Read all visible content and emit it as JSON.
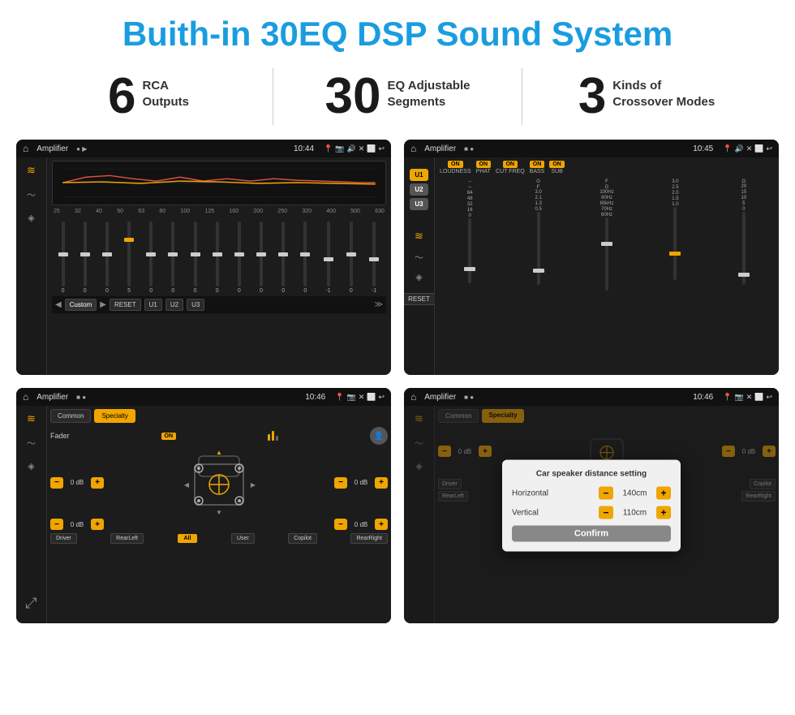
{
  "header": {
    "title": "Buith-in 30EQ DSP Sound System"
  },
  "stats": [
    {
      "number": "6",
      "label": "RCA\nOutputs"
    },
    {
      "number": "30",
      "label": "EQ Adjustable\nSegments"
    },
    {
      "number": "3",
      "label": "Kinds of\nCrossover Modes"
    }
  ],
  "screens": {
    "top_left": {
      "status_bar": {
        "title": "Amplifier",
        "time": "10:44"
      },
      "eq_freqs": [
        "25",
        "32",
        "40",
        "50",
        "63",
        "80",
        "100",
        "125",
        "160",
        "200",
        "250",
        "320",
        "400",
        "500",
        "630"
      ],
      "eq_values": [
        "0",
        "0",
        "0",
        "5",
        "0",
        "0",
        "0",
        "0",
        "0",
        "0",
        "0",
        "0",
        "-1",
        "0",
        "-1"
      ],
      "bottom_buttons": [
        "Custom",
        "RESET",
        "U1",
        "U2",
        "U3"
      ]
    },
    "top_right": {
      "status_bar": {
        "title": "Amplifier",
        "time": "10:45"
      },
      "u_buttons": [
        "U1",
        "U2",
        "U3"
      ],
      "columns": [
        "LOUDNESS",
        "PHAT",
        "CUT FREQ",
        "BASS",
        "SUB"
      ],
      "reset_label": "RESET"
    },
    "bottom_left": {
      "status_bar": {
        "title": "Amplifier",
        "time": "10:46"
      },
      "tabs": [
        "Common",
        "Specialty"
      ],
      "fader_label": "Fader",
      "fader_on": "ON",
      "speaker_rows": [
        {
          "left_db": "0 dB",
          "right_db": "0 dB"
        },
        {
          "left_db": "0 dB",
          "right_db": "0 dB"
        }
      ],
      "bottom_buttons": [
        "Driver",
        "Copilot",
        "RearLeft",
        "All",
        "User",
        "RearRight"
      ]
    },
    "bottom_right": {
      "status_bar": {
        "title": "Amplifier",
        "time": "10:46"
      },
      "dialog": {
        "title": "Car speaker distance setting",
        "horizontal_label": "Horizontal",
        "horizontal_value": "140cm",
        "vertical_label": "Vertical",
        "vertical_value": "110cm",
        "confirm_label": "Confirm",
        "right_db1": "0 dB",
        "right_db2": "0 dB"
      }
    }
  },
  "icons": {
    "home": "⌂",
    "eq_icon": "≋",
    "wave_icon": "〜",
    "speaker_icon": "◈",
    "expand_icon": "⤢",
    "pin_icon": "📍",
    "camera": "📷",
    "volume": "🔊",
    "close": "✕",
    "back": "↩",
    "minus": "−",
    "plus": "+"
  }
}
